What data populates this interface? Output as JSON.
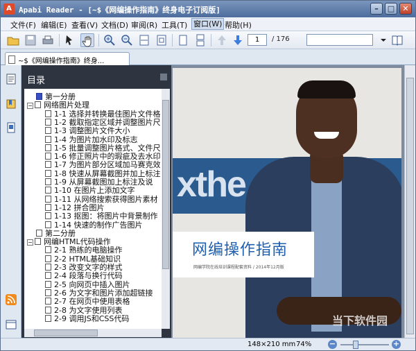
{
  "window": {
    "title": "Apabi Reader - [~$《网编操作指南》终身电子订阅版]",
    "app_icon_letter": "A"
  },
  "menu": {
    "items": [
      "文件(F)",
      "编辑(E)",
      "查看(V)",
      "文档(D)",
      "审阅(R)",
      "工具(T)",
      "窗口(W)",
      "帮助(H)"
    ]
  },
  "toolbar": {
    "current_page": "1",
    "total_pages": "/ 176",
    "search_value": ""
  },
  "tab": {
    "label": "~$《网编操作指南》终身..."
  },
  "toc": {
    "header": "目录",
    "items": [
      {
        "text": "第一分册",
        "level": 0,
        "kind": "blue"
      },
      {
        "text": "网络图片处理",
        "level": 0,
        "kind": "expand"
      },
      {
        "text": "1-1 选择并转换最佳图片文件格",
        "level": 1
      },
      {
        "text": "1-2 截取指定区域并调整图片尺",
        "level": 1
      },
      {
        "text": "1-3 调整图片文件大小",
        "level": 1
      },
      {
        "text": "1-4 为图片加水印及标志",
        "level": 1
      },
      {
        "text": "1-5 批量调整图片格式、文件尺",
        "level": 1
      },
      {
        "text": "1-6 修正照片中的瑕疵及去水印",
        "level": 1
      },
      {
        "text": "1-7 为图片部分区域加马赛克效",
        "level": 1
      },
      {
        "text": "1-8 快速从屏幕截图并加上标注",
        "level": 1
      },
      {
        "text": "1-9 从屏幕截图加上标注及说",
        "level": 1
      },
      {
        "text": "1-10 在图片上添加文字",
        "level": 1
      },
      {
        "text": "1-11 从网络搜索获得图片素材",
        "level": 1
      },
      {
        "text": "1-12 拼合图片",
        "level": 1
      },
      {
        "text": "1-13 抠图：将图片中背景制作",
        "level": 1
      },
      {
        "text": "1-14 快速的制作广告图片",
        "level": 1
      },
      {
        "text": "第二分册",
        "level": 0,
        "kind": "plain"
      },
      {
        "text": "网编HTML代码操作",
        "level": 0,
        "kind": "expand"
      },
      {
        "text": "2-1 熟练的电脑操作",
        "level": 1
      },
      {
        "text": "2-2 HTML基础知识",
        "level": 1
      },
      {
        "text": "2-3 改变文字的样式",
        "level": 1
      },
      {
        "text": "2-4 段落与换行代码",
        "level": 1
      },
      {
        "text": "2-5 向网页中插入图片",
        "level": 1
      },
      {
        "text": "2-6 为文字和图片添加超链接",
        "level": 1
      },
      {
        "text": "2-7 在网页中使用表格",
        "level": 1
      },
      {
        "text": "2-8 为文字使用列表",
        "level": 1
      },
      {
        "text": "2-9 调用JS和CSS代码",
        "level": 1
      }
    ]
  },
  "document": {
    "board_text": "xthe",
    "cover_title": "网编操作指南",
    "cover_subtitle": "网编学院在线培训课程配套资料 / 2014年12月版"
  },
  "status": {
    "page_size": "148×210 mm",
    "zoom": "74%"
  },
  "watermark": "当下软件园"
}
